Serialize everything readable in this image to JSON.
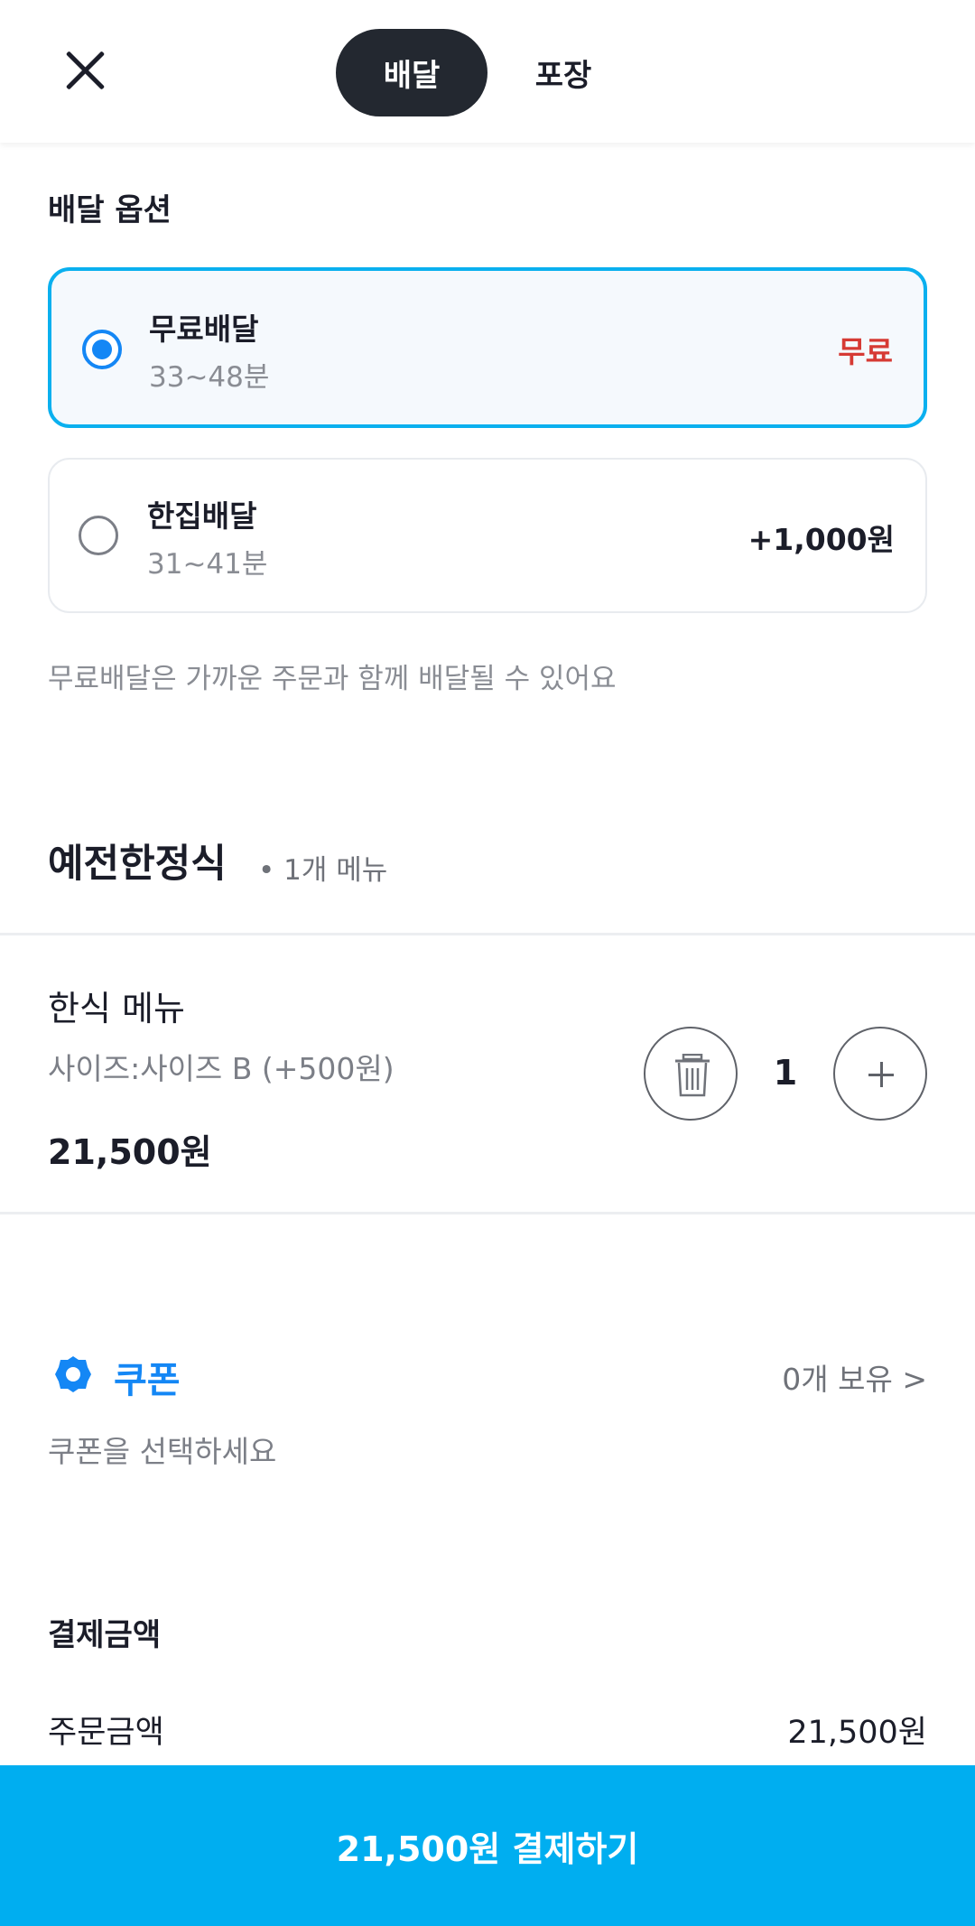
{
  "header": {
    "tabs": [
      {
        "label": "배달",
        "selected": true
      },
      {
        "label": "포장",
        "selected": false
      }
    ]
  },
  "delivery_options": {
    "title": "배달 옵션",
    "options": [
      {
        "name": "무료배달",
        "time": "33~48분",
        "price": "무료",
        "selected": true
      },
      {
        "name": "한집배달",
        "time": "31~41분",
        "price": "+1,000원",
        "selected": false
      }
    ],
    "note": "무료배달은 가까운 주문과 함께 배달될 수 있어요"
  },
  "store": {
    "name": "예전한정식",
    "menu_count": "• 1개 메뉴"
  },
  "cart_item": {
    "name": "한식 메뉴",
    "option": "사이즈:사이즈 B (+500원)",
    "price": "21,500원",
    "quantity": "1"
  },
  "coupon": {
    "title": "쿠폰",
    "count": "0개 보유 >",
    "hint": "쿠폰을 선택하세요"
  },
  "payment": {
    "title": "결제금액",
    "order_amount_label": "주문금액",
    "order_amount_value": "21,500원"
  },
  "pay_button": {
    "label": "21,500원 결제하기"
  },
  "colors": {
    "accent": "#00aef0",
    "selected_border": "#0ab0ef",
    "radio": "#1487f5",
    "free_price": "#d63a34",
    "dark_tab": "#232830"
  }
}
